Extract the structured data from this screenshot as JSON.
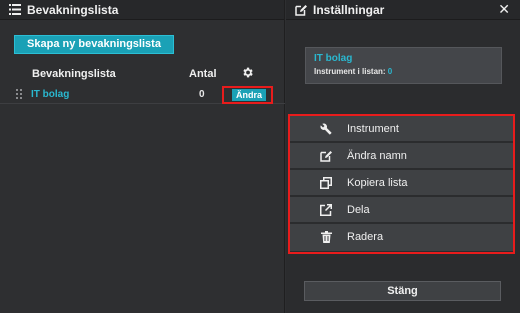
{
  "left": {
    "title": "Bevakningslista",
    "create_label": "Skapa ny bevakningslista",
    "col_name": "Bevakningslista",
    "col_count": "Antal",
    "row": {
      "name": "IT bolag",
      "count": "0",
      "edit_label": "Ändra"
    }
  },
  "right": {
    "title": "Inställningar",
    "info": {
      "name": "IT bolag",
      "count_label": "Instrument i listan:",
      "count_value": "0"
    },
    "menu": [
      {
        "label": "Instrument",
        "icon": "wrench-icon"
      },
      {
        "label": "Ändra namn",
        "icon": "edit-icon"
      },
      {
        "label": "Kopiera lista",
        "icon": "copy-icon"
      },
      {
        "label": "Dela",
        "icon": "share-icon"
      },
      {
        "label": "Radera",
        "icon": "trash-icon"
      }
    ],
    "close_label": "Stäng"
  },
  "colors": {
    "accent": "#1aa1b6",
    "link": "#2ab8d0",
    "highlight": "#e81c1c"
  }
}
